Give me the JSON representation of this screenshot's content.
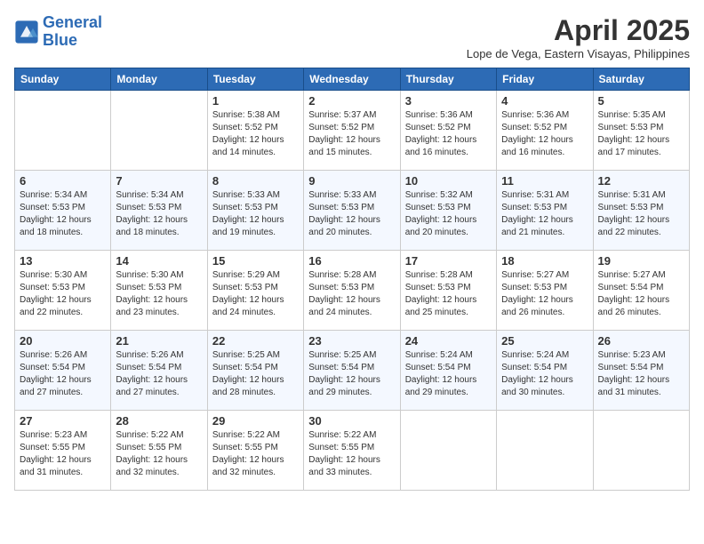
{
  "header": {
    "logo_line1": "General",
    "logo_line2": "Blue",
    "month": "April 2025",
    "location": "Lope de Vega, Eastern Visayas, Philippines"
  },
  "days": [
    "Sunday",
    "Monday",
    "Tuesday",
    "Wednesday",
    "Thursday",
    "Friday",
    "Saturday"
  ],
  "weeks": [
    [
      {
        "num": "",
        "info": ""
      },
      {
        "num": "",
        "info": ""
      },
      {
        "num": "1",
        "info": "Sunrise: 5:38 AM\nSunset: 5:52 PM\nDaylight: 12 hours and 14 minutes."
      },
      {
        "num": "2",
        "info": "Sunrise: 5:37 AM\nSunset: 5:52 PM\nDaylight: 12 hours and 15 minutes."
      },
      {
        "num": "3",
        "info": "Sunrise: 5:36 AM\nSunset: 5:52 PM\nDaylight: 12 hours and 16 minutes."
      },
      {
        "num": "4",
        "info": "Sunrise: 5:36 AM\nSunset: 5:52 PM\nDaylight: 12 hours and 16 minutes."
      },
      {
        "num": "5",
        "info": "Sunrise: 5:35 AM\nSunset: 5:53 PM\nDaylight: 12 hours and 17 minutes."
      }
    ],
    [
      {
        "num": "6",
        "info": "Sunrise: 5:34 AM\nSunset: 5:53 PM\nDaylight: 12 hours and 18 minutes."
      },
      {
        "num": "7",
        "info": "Sunrise: 5:34 AM\nSunset: 5:53 PM\nDaylight: 12 hours and 18 minutes."
      },
      {
        "num": "8",
        "info": "Sunrise: 5:33 AM\nSunset: 5:53 PM\nDaylight: 12 hours and 19 minutes."
      },
      {
        "num": "9",
        "info": "Sunrise: 5:33 AM\nSunset: 5:53 PM\nDaylight: 12 hours and 20 minutes."
      },
      {
        "num": "10",
        "info": "Sunrise: 5:32 AM\nSunset: 5:53 PM\nDaylight: 12 hours and 20 minutes."
      },
      {
        "num": "11",
        "info": "Sunrise: 5:31 AM\nSunset: 5:53 PM\nDaylight: 12 hours and 21 minutes."
      },
      {
        "num": "12",
        "info": "Sunrise: 5:31 AM\nSunset: 5:53 PM\nDaylight: 12 hours and 22 minutes."
      }
    ],
    [
      {
        "num": "13",
        "info": "Sunrise: 5:30 AM\nSunset: 5:53 PM\nDaylight: 12 hours and 22 minutes."
      },
      {
        "num": "14",
        "info": "Sunrise: 5:30 AM\nSunset: 5:53 PM\nDaylight: 12 hours and 23 minutes."
      },
      {
        "num": "15",
        "info": "Sunrise: 5:29 AM\nSunset: 5:53 PM\nDaylight: 12 hours and 24 minutes."
      },
      {
        "num": "16",
        "info": "Sunrise: 5:28 AM\nSunset: 5:53 PM\nDaylight: 12 hours and 24 minutes."
      },
      {
        "num": "17",
        "info": "Sunrise: 5:28 AM\nSunset: 5:53 PM\nDaylight: 12 hours and 25 minutes."
      },
      {
        "num": "18",
        "info": "Sunrise: 5:27 AM\nSunset: 5:53 PM\nDaylight: 12 hours and 26 minutes."
      },
      {
        "num": "19",
        "info": "Sunrise: 5:27 AM\nSunset: 5:54 PM\nDaylight: 12 hours and 26 minutes."
      }
    ],
    [
      {
        "num": "20",
        "info": "Sunrise: 5:26 AM\nSunset: 5:54 PM\nDaylight: 12 hours and 27 minutes."
      },
      {
        "num": "21",
        "info": "Sunrise: 5:26 AM\nSunset: 5:54 PM\nDaylight: 12 hours and 27 minutes."
      },
      {
        "num": "22",
        "info": "Sunrise: 5:25 AM\nSunset: 5:54 PM\nDaylight: 12 hours and 28 minutes."
      },
      {
        "num": "23",
        "info": "Sunrise: 5:25 AM\nSunset: 5:54 PM\nDaylight: 12 hours and 29 minutes."
      },
      {
        "num": "24",
        "info": "Sunrise: 5:24 AM\nSunset: 5:54 PM\nDaylight: 12 hours and 29 minutes."
      },
      {
        "num": "25",
        "info": "Sunrise: 5:24 AM\nSunset: 5:54 PM\nDaylight: 12 hours and 30 minutes."
      },
      {
        "num": "26",
        "info": "Sunrise: 5:23 AM\nSunset: 5:54 PM\nDaylight: 12 hours and 31 minutes."
      }
    ],
    [
      {
        "num": "27",
        "info": "Sunrise: 5:23 AM\nSunset: 5:55 PM\nDaylight: 12 hours and 31 minutes."
      },
      {
        "num": "28",
        "info": "Sunrise: 5:22 AM\nSunset: 5:55 PM\nDaylight: 12 hours and 32 minutes."
      },
      {
        "num": "29",
        "info": "Sunrise: 5:22 AM\nSunset: 5:55 PM\nDaylight: 12 hours and 32 minutes."
      },
      {
        "num": "30",
        "info": "Sunrise: 5:22 AM\nSunset: 5:55 PM\nDaylight: 12 hours and 33 minutes."
      },
      {
        "num": "",
        "info": ""
      },
      {
        "num": "",
        "info": ""
      },
      {
        "num": "",
        "info": ""
      }
    ]
  ]
}
